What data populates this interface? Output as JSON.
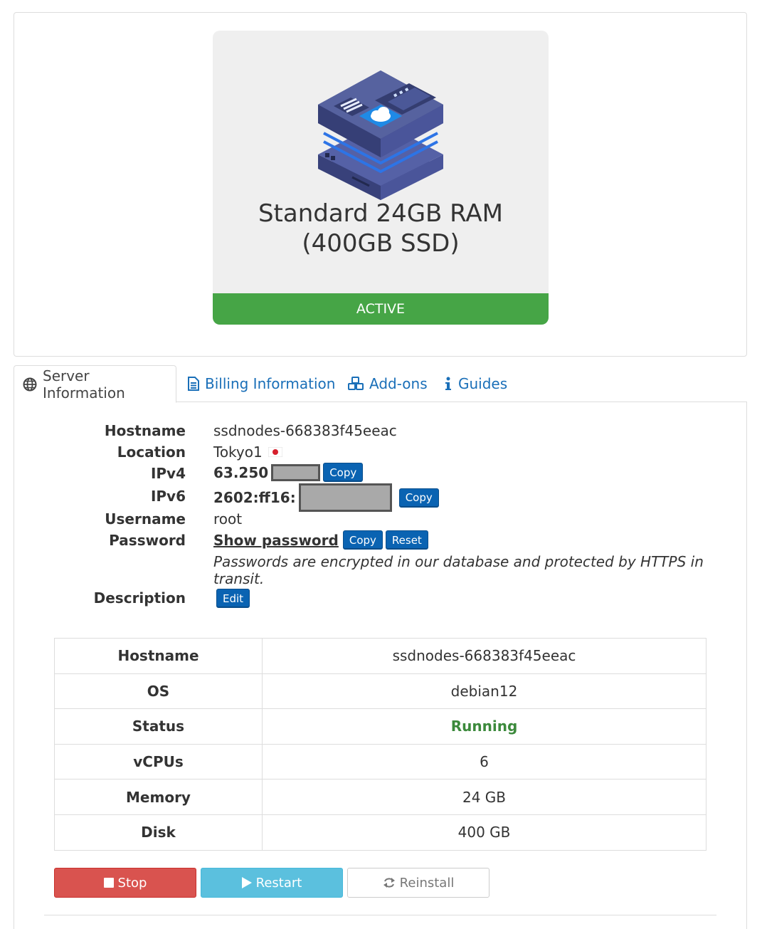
{
  "product": {
    "name_line1": "Standard 24GB RAM",
    "name_line2": "(400GB SSD)",
    "status": "ACTIVE",
    "status_color": "#46a546",
    "icon": "cloud-server-icon"
  },
  "tabs": [
    {
      "label": "Server Information",
      "icon": "globe-icon",
      "active": true
    },
    {
      "label": "Billing Information",
      "icon": "document-icon",
      "active": false
    },
    {
      "label": "Add-ons",
      "icon": "cubes-icon",
      "active": false
    },
    {
      "label": "Guides",
      "icon": "info-icon",
      "active": false
    }
  ],
  "info": {
    "hostname_label": "Hostname",
    "hostname": "ssdnodes-668383f45eeac",
    "location_label": "Location",
    "location": "Tokyo1",
    "location_flag": "japan-flag-icon",
    "ipv4_label": "IPv4",
    "ipv4": "63.250",
    "ipv6_label": "IPv6",
    "ipv6": "2602:ff16:",
    "username_label": "Username",
    "username": "root",
    "password_label": "Password",
    "show_password": "Show password",
    "copy": "Copy",
    "reset": "Reset",
    "password_note": "Passwords are encrypted in our database and protected by HTTPS in transit.",
    "description_label": "Description",
    "edit": "Edit"
  },
  "specs": [
    {
      "key": "Hostname",
      "value": "ssdnodes-668383f45eeac"
    },
    {
      "key": "OS",
      "value": "debian12"
    },
    {
      "key": "Status",
      "value": "Running"
    },
    {
      "key": "vCPUs",
      "value": "6"
    },
    {
      "key": "Memory",
      "value": "24 GB"
    },
    {
      "key": "Disk",
      "value": "400 GB"
    }
  ],
  "actions": {
    "stop": "Stop",
    "restart": "Restart",
    "reinstall": "Reinstall"
  },
  "colors": {
    "link_blue": "#1a6fb8",
    "button_blue": "#0a63b2",
    "stop_red": "#d9534f",
    "restart_cyan": "#5bc0de",
    "running_green": "#3c8a3c"
  }
}
